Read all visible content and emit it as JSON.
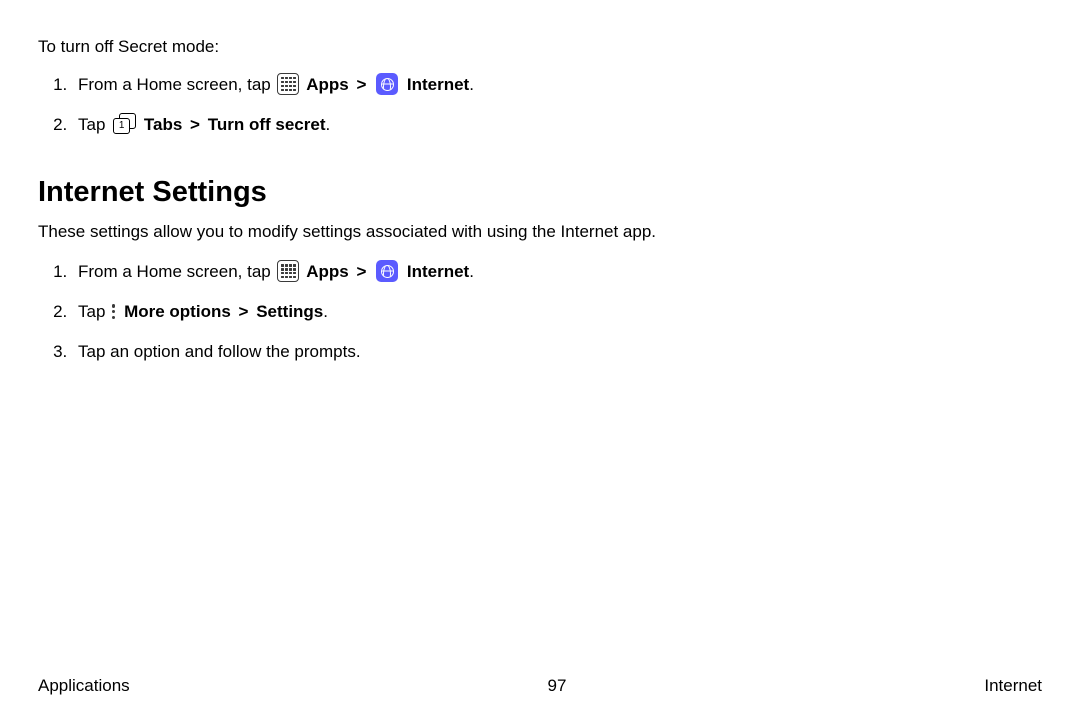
{
  "secret_off": {
    "intro": "To turn off Secret mode:",
    "step1_lead": "From a Home screen, tap",
    "apps_label": "Apps",
    "internet_label": "Internet",
    "step2_lead": "Tap",
    "tabs_number": "1",
    "tabs_label": "Tabs",
    "turn_off_label": "Turn off secret"
  },
  "settings": {
    "title": "Internet Settings",
    "desc": "These settings allow you to modify settings associated with using the Internet app.",
    "step1_lead": "From a Home screen, tap",
    "apps_label": "Apps",
    "internet_label": "Internet",
    "step2_lead": "Tap",
    "more_options_label": "More options",
    "settings_label": "Settings",
    "step3_text": "Tap an option and follow the prompts."
  },
  "arrow": ">",
  "period": ".",
  "footer": {
    "left": "Applications",
    "page": "97",
    "right": "Internet"
  }
}
